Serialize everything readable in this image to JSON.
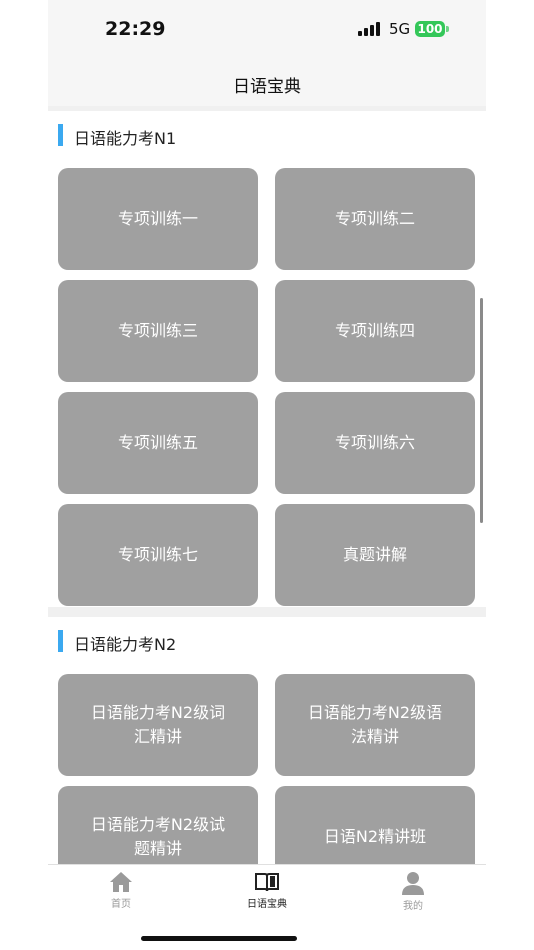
{
  "status_bar": {
    "time": "22:29",
    "network": "5G",
    "battery": "100"
  },
  "nav": {
    "title": "日语宝典"
  },
  "sections": [
    {
      "title": "日语能力考N1",
      "items": [
        "专项训练一",
        "专项训练二",
        "专项训练三",
        "专项训练四",
        "专项训练五",
        "专项训练六",
        "专项训练七",
        "真题讲解"
      ]
    },
    {
      "title": "日语能力考N2",
      "items": [
        "日语能力考N2级词汇精讲",
        "日语能力考N2级语法精讲",
        "日语能力考N2级试题精讲",
        "日语N2精讲班"
      ]
    }
  ],
  "tabs": [
    {
      "label": "首页",
      "icon": "home-icon",
      "active": false
    },
    {
      "label": "日语宝典",
      "icon": "book-icon",
      "active": true
    },
    {
      "label": "我的",
      "icon": "user-icon",
      "active": false
    }
  ],
  "colors": {
    "accent": "#3ba9f0",
    "tile": "#a0a0a0",
    "tab_inactive": "#9a9a9a",
    "tab_active": "#222222"
  }
}
